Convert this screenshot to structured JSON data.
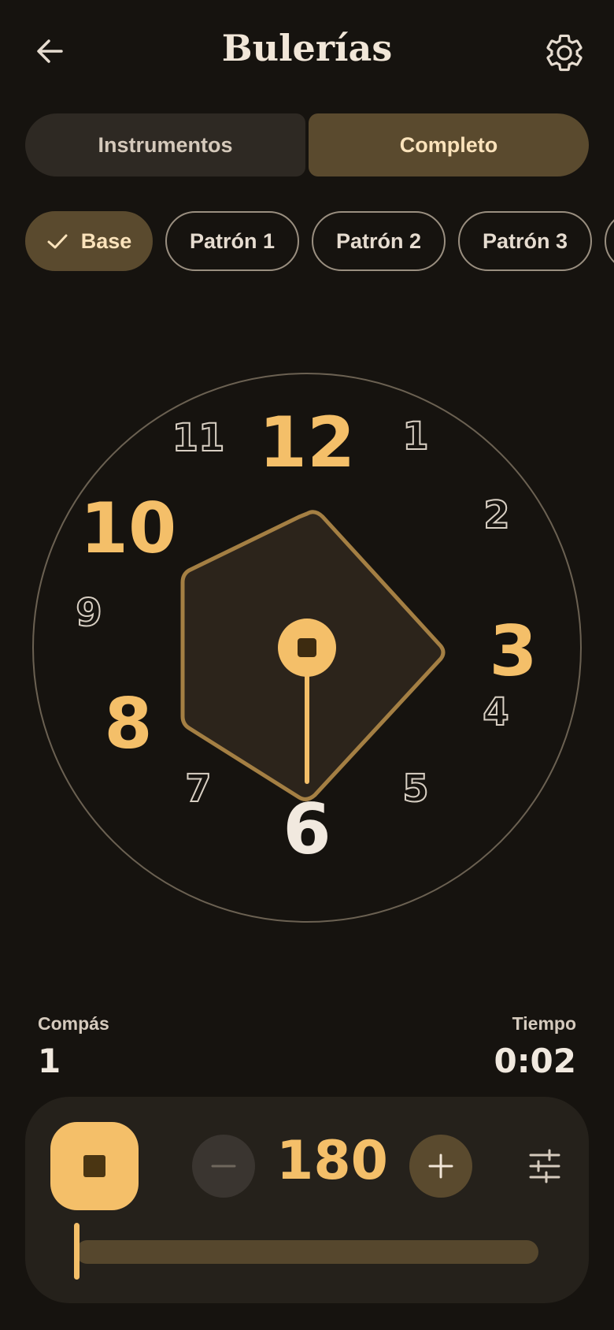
{
  "header": {
    "title": "Bulerías",
    "back_icon": "arrow-left-icon",
    "settings_icon": "gear-icon"
  },
  "segments": {
    "left": "Instrumentos",
    "right": "Completo",
    "selected": "Completo"
  },
  "chips": [
    {
      "label": "Base",
      "selected": true
    },
    {
      "label": "Patrón 1",
      "selected": false
    },
    {
      "label": "Patrón 2",
      "selected": false
    },
    {
      "label": "Patrón 3",
      "selected": false
    },
    {
      "label": "",
      "selected": false
    }
  ],
  "clock": {
    "numbers": [
      "12",
      "1",
      "2",
      "3",
      "4",
      "5",
      "6",
      "7",
      "8",
      "9",
      "10",
      "11"
    ],
    "accented": [
      "12",
      "3",
      "8",
      "10"
    ],
    "current": "6"
  },
  "stats": {
    "compas_label": "Compás",
    "compas_value": "1",
    "tiempo_label": "Tiempo",
    "tiempo_value": "0:02"
  },
  "controls": {
    "bpm": "180",
    "progress": 0
  },
  "colors": {
    "background": "#16130f",
    "accent": "#f4bf69",
    "selected": "#5a4a2e",
    "current": "#f1e9df"
  }
}
